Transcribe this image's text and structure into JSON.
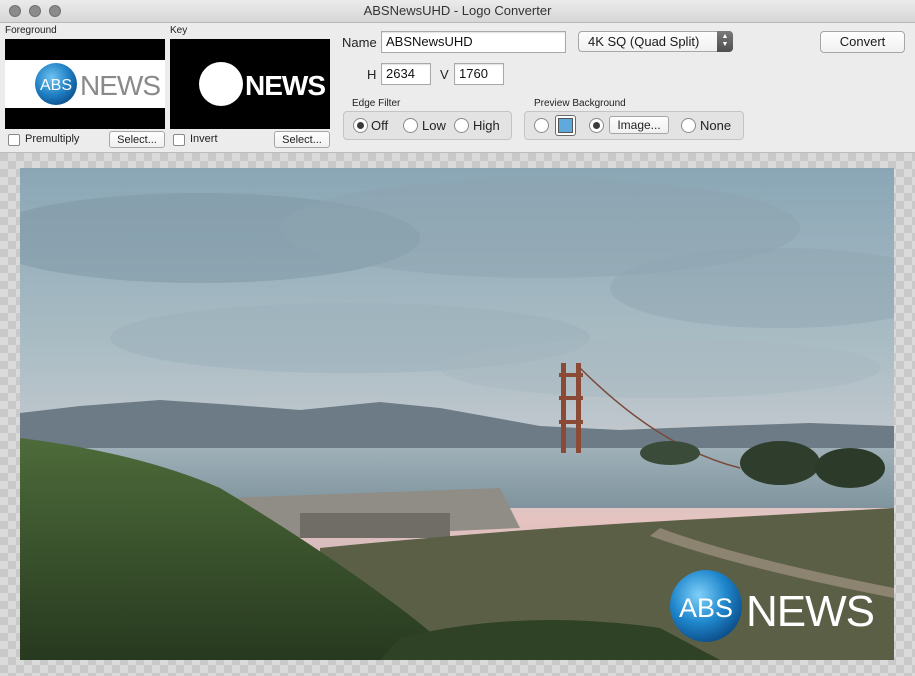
{
  "window": {
    "title": "ABSNewsUHD - Logo Converter"
  },
  "foreground": {
    "label": "Foreground",
    "logo": {
      "abs": "ABS",
      "news": "NEWS"
    },
    "premultiply_label": "Premultiply",
    "premultiply_checked": false,
    "select_label": "Select..."
  },
  "key": {
    "label": "Key",
    "logo_news": "NEWS",
    "invert_label": "Invert",
    "invert_checked": false,
    "select_label": "Select..."
  },
  "name": {
    "label": "Name",
    "value": "ABSNewsUHD"
  },
  "format": {
    "selected": "4K SQ (Quad Split)"
  },
  "convert_label": "Convert",
  "size": {
    "h_label": "H",
    "h_value": "2634",
    "v_label": "V",
    "v_value": "1760"
  },
  "edge_filter": {
    "label": "Edge Filter",
    "options": [
      "Off",
      "Low",
      "High"
    ],
    "selected": "Off"
  },
  "preview_background": {
    "label": "Preview Background",
    "swatch_color": "#5fa9dc",
    "image_label": "Image...",
    "none_label": "None",
    "selected": "image"
  },
  "preview": {
    "overlay_logo": {
      "abs": "ABS",
      "news": "NEWS"
    }
  }
}
